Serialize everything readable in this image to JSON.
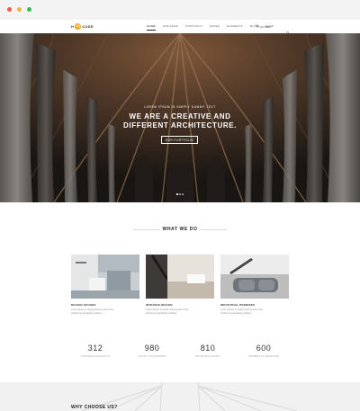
{
  "window": {
    "controls": [
      "close",
      "minimize",
      "maximize"
    ]
  },
  "header": {
    "logo_prefix": "H",
    "logo_circle": "",
    "logo_suffix": "CODE",
    "nav": [
      "HOME",
      "ONE PAGE",
      "PORTFOLIO",
      "PAGES",
      "ELEMENTS",
      "BLOG",
      "SHOP"
    ],
    "active_nav": "HOME",
    "cart_label": "(0) ITEM",
    "cart_icon": "cart-icon",
    "search_icon": "search-icon",
    "accent": "#f0a623"
  },
  "hero": {
    "kicker": "LOREM IPSUM IS SIMPLY DUMMY TEXT",
    "title_line1": "WE ARE A CREATIVE AND",
    "title_line2": "DIFFERENT ARCHITECTURE.",
    "button": "OUR PORTFOLIO",
    "slides": 3,
    "active_slide": 1
  },
  "what_we_do": {
    "title": "WHAT WE DO",
    "cards": [
      {
        "title": "DESIGN HOUSES",
        "text_line1": "Lorem Ipsum is simply dummy text of the",
        "text_line2": "printing & typesetting industry."
      },
      {
        "title": "INTERIOR DESIGN",
        "text_line1": "Lorem Ipsum is simply dummy text of the",
        "text_line2": "printing & typesetting industry."
      },
      {
        "title": "INDUSTRIAL PREMISES",
        "text_line1": "Lorem Ipsum is simply dummy text of the",
        "text_line2": "printing & typesetting industry."
      }
    ]
  },
  "stats": [
    {
      "value": "312",
      "label": "FINISHED PROJECTS"
    },
    {
      "value": "980",
      "label": "HAPPY CUSTOMERS"
    },
    {
      "value": "810",
      "label": "WORKING HOURS"
    },
    {
      "value": "600",
      "label": "COMMENTS RECEIVED"
    }
  ],
  "why": {
    "title": "WHY CHOOSE US?"
  }
}
